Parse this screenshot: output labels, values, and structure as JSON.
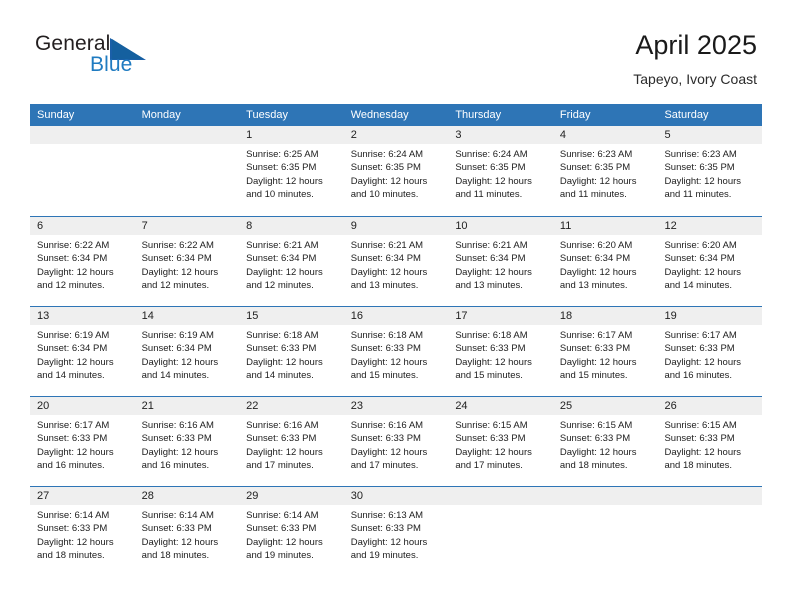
{
  "brand": {
    "name_part1": "General",
    "name_part2": "Blue",
    "mark_icon": "triangle-flag-icon",
    "accent_color": "#1f7bc1"
  },
  "header": {
    "title": "April 2025",
    "subtitle": "Tapeyo, Ivory Coast"
  },
  "theme": {
    "header_blue": "#2e75b6",
    "band_gray": "#efefef",
    "text_dark": "#1d1d1d"
  },
  "calendar": {
    "weekdays": [
      "Sunday",
      "Monday",
      "Tuesday",
      "Wednesday",
      "Thursday",
      "Friday",
      "Saturday"
    ],
    "weeks": [
      [
        {
          "day": "",
          "lines": []
        },
        {
          "day": "",
          "lines": []
        },
        {
          "day": "1",
          "lines": [
            "Sunrise: 6:25 AM",
            "Sunset: 6:35 PM",
            "Daylight: 12 hours",
            "and 10 minutes."
          ]
        },
        {
          "day": "2",
          "lines": [
            "Sunrise: 6:24 AM",
            "Sunset: 6:35 PM",
            "Daylight: 12 hours",
            "and 10 minutes."
          ]
        },
        {
          "day": "3",
          "lines": [
            "Sunrise: 6:24 AM",
            "Sunset: 6:35 PM",
            "Daylight: 12 hours",
            "and 11 minutes."
          ]
        },
        {
          "day": "4",
          "lines": [
            "Sunrise: 6:23 AM",
            "Sunset: 6:35 PM",
            "Daylight: 12 hours",
            "and 11 minutes."
          ]
        },
        {
          "day": "5",
          "lines": [
            "Sunrise: 6:23 AM",
            "Sunset: 6:35 PM",
            "Daylight: 12 hours",
            "and 11 minutes."
          ]
        }
      ],
      [
        {
          "day": "6",
          "lines": [
            "Sunrise: 6:22 AM",
            "Sunset: 6:34 PM",
            "Daylight: 12 hours",
            "and 12 minutes."
          ]
        },
        {
          "day": "7",
          "lines": [
            "Sunrise: 6:22 AM",
            "Sunset: 6:34 PM",
            "Daylight: 12 hours",
            "and 12 minutes."
          ]
        },
        {
          "day": "8",
          "lines": [
            "Sunrise: 6:21 AM",
            "Sunset: 6:34 PM",
            "Daylight: 12 hours",
            "and 12 minutes."
          ]
        },
        {
          "day": "9",
          "lines": [
            "Sunrise: 6:21 AM",
            "Sunset: 6:34 PM",
            "Daylight: 12 hours",
            "and 13 minutes."
          ]
        },
        {
          "day": "10",
          "lines": [
            "Sunrise: 6:21 AM",
            "Sunset: 6:34 PM",
            "Daylight: 12 hours",
            "and 13 minutes."
          ]
        },
        {
          "day": "11",
          "lines": [
            "Sunrise: 6:20 AM",
            "Sunset: 6:34 PM",
            "Daylight: 12 hours",
            "and 13 minutes."
          ]
        },
        {
          "day": "12",
          "lines": [
            "Sunrise: 6:20 AM",
            "Sunset: 6:34 PM",
            "Daylight: 12 hours",
            "and 14 minutes."
          ]
        }
      ],
      [
        {
          "day": "13",
          "lines": [
            "Sunrise: 6:19 AM",
            "Sunset: 6:34 PM",
            "Daylight: 12 hours",
            "and 14 minutes."
          ]
        },
        {
          "day": "14",
          "lines": [
            "Sunrise: 6:19 AM",
            "Sunset: 6:34 PM",
            "Daylight: 12 hours",
            "and 14 minutes."
          ]
        },
        {
          "day": "15",
          "lines": [
            "Sunrise: 6:18 AM",
            "Sunset: 6:33 PM",
            "Daylight: 12 hours",
            "and 14 minutes."
          ]
        },
        {
          "day": "16",
          "lines": [
            "Sunrise: 6:18 AM",
            "Sunset: 6:33 PM",
            "Daylight: 12 hours",
            "and 15 minutes."
          ]
        },
        {
          "day": "17",
          "lines": [
            "Sunrise: 6:18 AM",
            "Sunset: 6:33 PM",
            "Daylight: 12 hours",
            "and 15 minutes."
          ]
        },
        {
          "day": "18",
          "lines": [
            "Sunrise: 6:17 AM",
            "Sunset: 6:33 PM",
            "Daylight: 12 hours",
            "and 15 minutes."
          ]
        },
        {
          "day": "19",
          "lines": [
            "Sunrise: 6:17 AM",
            "Sunset: 6:33 PM",
            "Daylight: 12 hours",
            "and 16 minutes."
          ]
        }
      ],
      [
        {
          "day": "20",
          "lines": [
            "Sunrise: 6:17 AM",
            "Sunset: 6:33 PM",
            "Daylight: 12 hours",
            "and 16 minutes."
          ]
        },
        {
          "day": "21",
          "lines": [
            "Sunrise: 6:16 AM",
            "Sunset: 6:33 PM",
            "Daylight: 12 hours",
            "and 16 minutes."
          ]
        },
        {
          "day": "22",
          "lines": [
            "Sunrise: 6:16 AM",
            "Sunset: 6:33 PM",
            "Daylight: 12 hours",
            "and 17 minutes."
          ]
        },
        {
          "day": "23",
          "lines": [
            "Sunrise: 6:16 AM",
            "Sunset: 6:33 PM",
            "Daylight: 12 hours",
            "and 17 minutes."
          ]
        },
        {
          "day": "24",
          "lines": [
            "Sunrise: 6:15 AM",
            "Sunset: 6:33 PM",
            "Daylight: 12 hours",
            "and 17 minutes."
          ]
        },
        {
          "day": "25",
          "lines": [
            "Sunrise: 6:15 AM",
            "Sunset: 6:33 PM",
            "Daylight: 12 hours",
            "and 18 minutes."
          ]
        },
        {
          "day": "26",
          "lines": [
            "Sunrise: 6:15 AM",
            "Sunset: 6:33 PM",
            "Daylight: 12 hours",
            "and 18 minutes."
          ]
        }
      ],
      [
        {
          "day": "27",
          "lines": [
            "Sunrise: 6:14 AM",
            "Sunset: 6:33 PM",
            "Daylight: 12 hours",
            "and 18 minutes."
          ]
        },
        {
          "day": "28",
          "lines": [
            "Sunrise: 6:14 AM",
            "Sunset: 6:33 PM",
            "Daylight: 12 hours",
            "and 18 minutes."
          ]
        },
        {
          "day": "29",
          "lines": [
            "Sunrise: 6:14 AM",
            "Sunset: 6:33 PM",
            "Daylight: 12 hours",
            "and 19 minutes."
          ]
        },
        {
          "day": "30",
          "lines": [
            "Sunrise: 6:13 AM",
            "Sunset: 6:33 PM",
            "Daylight: 12 hours",
            "and 19 minutes."
          ]
        },
        {
          "day": "",
          "lines": []
        },
        {
          "day": "",
          "lines": []
        },
        {
          "day": "",
          "lines": []
        }
      ]
    ]
  }
}
